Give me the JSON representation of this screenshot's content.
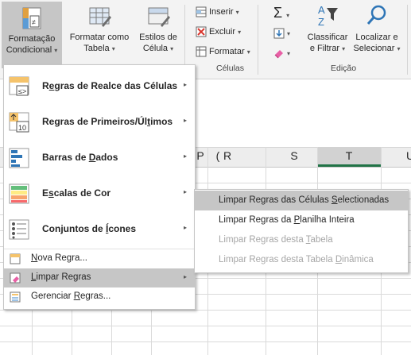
{
  "ribbon": {
    "formatacao": {
      "line1": "Formatação",
      "line2": "Condicional",
      "caret": "▾"
    },
    "formatar_tabela": {
      "line1": "Formatar como",
      "line2": "Tabela",
      "caret": "▾"
    },
    "estilos": {
      "line1": "Estilos de",
      "line2": "Célula",
      "caret": "▾"
    },
    "cells": {
      "inserir": "Inserir",
      "excluir": "Excluir",
      "formatar": "Formatar",
      "group_label": "Células"
    },
    "editing": {
      "sigma": "Σ",
      "classificar_line1": "Classificar",
      "classificar_line2": "e Filtrar",
      "localizar_line1": "Localizar e",
      "localizar_line2": "Selecionar",
      "group_label": "Edição"
    }
  },
  "grid": {
    "columns": [
      "P",
      "(",
      "R",
      "S",
      "T",
      "U"
    ],
    "selected_column": "T"
  },
  "menu": {
    "items": [
      {
        "pre": "R",
        "ul": "e",
        "post": "gras de Realce das Células"
      },
      {
        "pre": "Regras de Primeiros/Úl",
        "ul": "t",
        "post": "imos"
      },
      {
        "pre": "Barras de ",
        "ul": "D",
        "post": "ados"
      },
      {
        "pre": "E",
        "ul": "s",
        "post": "calas de Cor"
      },
      {
        "pre": "Conjuntos de ",
        "ul": "Í",
        "post": "cones"
      }
    ],
    "nova_regra": {
      "ul": "N",
      "post": "ova Regra..."
    },
    "limpar_regras": {
      "ul": "L",
      "post": "impar Regras"
    },
    "gerenciar": {
      "pre": "Gerenciar ",
      "ul": "R",
      "post": "egras..."
    },
    "arrow": "▸"
  },
  "submenu": {
    "items": [
      {
        "pre": "Limpar Regras das Células ",
        "ul": "S",
        "post": "electionadas"
      },
      {
        "pre": "Limpar Regras da ",
        "ul": "P",
        "post": "lanilha Inteira"
      },
      {
        "pre": "Limpar Regras desta ",
        "ul": "T",
        "post": "abela"
      },
      {
        "pre": "Limpar Regras desta Tabela ",
        "ul": "D",
        "post": "inâmica"
      }
    ]
  },
  "icons": {
    "highlight_rules": "highlight-cells-rules-icon",
    "top_bottom": "top-bottom-rules-icon",
    "data_bars": "data-bars-icon",
    "color_scales": "color-scales-icon",
    "icon_sets": "icon-sets-icon",
    "new_rule": "new-rule-icon",
    "clear_rules": "clear-rules-icon",
    "manage_rules": "manage-rules-icon"
  },
  "colors": {
    "accent": "#217346",
    "hover": "#c6c6c6",
    "disabled": "#a6a6a6"
  }
}
